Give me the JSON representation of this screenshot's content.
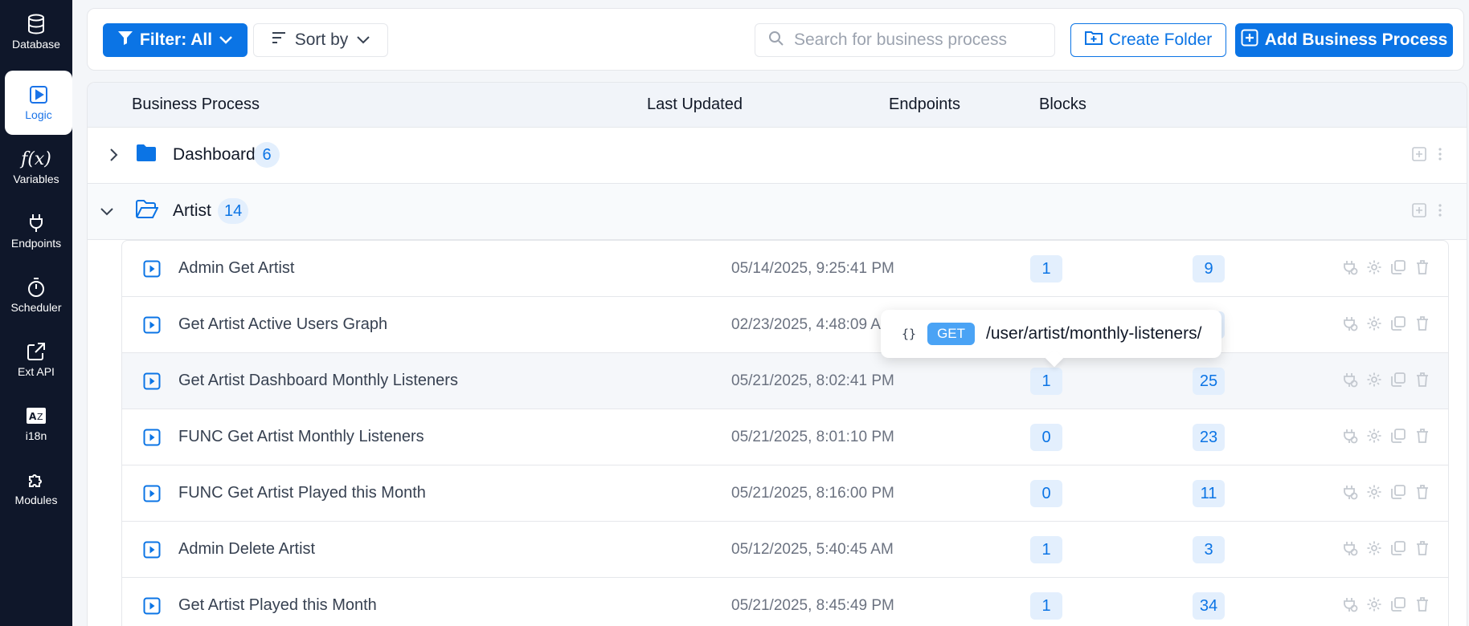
{
  "sidebar": {
    "items": [
      {
        "label": "Database",
        "icon": "database-icon"
      },
      {
        "label": "Logic",
        "icon": "play-square-icon",
        "active": true
      },
      {
        "label": "Variables",
        "icon": "function-icon"
      },
      {
        "label": "Endpoints",
        "icon": "plug-icon"
      },
      {
        "label": "Scheduler",
        "icon": "stopwatch-icon"
      },
      {
        "label": "Ext API",
        "icon": "external-link-icon"
      },
      {
        "label": "i18n",
        "icon": "translate-icon"
      },
      {
        "label": "Modules",
        "icon": "puzzle-icon"
      }
    ]
  },
  "toolbar": {
    "filter_label": "Filter: All",
    "sort_label": "Sort by",
    "search_placeholder": "Search for business process",
    "create_folder_label": "Create Folder",
    "add_process_label": "Add Business Process"
  },
  "table": {
    "headers": {
      "process": "Business Process",
      "updated": "Last Updated",
      "endpoints": "Endpoints",
      "blocks": "Blocks"
    },
    "folders": [
      {
        "name": "Dashboard",
        "count": "6",
        "expanded": false
      },
      {
        "name": "Artist",
        "count": "14",
        "expanded": true
      }
    ],
    "rows": [
      {
        "name": "Admin Get Artist",
        "updated": "05/14/2025, 9:25:41 PM",
        "endpoints": "1",
        "blocks": "9"
      },
      {
        "name": "Get Artist Active Users Graph",
        "updated": "02/23/2025, 4:48:09 AM",
        "endpoints": "",
        "blocks": ""
      },
      {
        "name": "Get Artist Dashboard Monthly Listeners",
        "updated": "05/21/2025, 8:02:41 PM",
        "endpoints": "1",
        "blocks": "25"
      },
      {
        "name": "FUNC Get Artist Monthly Listeners",
        "updated": "05/21/2025, 8:01:10 PM",
        "endpoints": "0",
        "blocks": "23"
      },
      {
        "name": "FUNC Get Artist Played this Month",
        "updated": "05/21/2025, 8:16:00 PM",
        "endpoints": "0",
        "blocks": "11"
      },
      {
        "name": "Admin Delete Artist",
        "updated": "05/12/2025, 5:40:45 AM",
        "endpoints": "1",
        "blocks": "3"
      },
      {
        "name": "Get Artist Played this Month",
        "updated": "05/21/2025, 8:45:49 PM",
        "endpoints": "1",
        "blocks": "34"
      }
    ]
  },
  "tooltip": {
    "method": "GET",
    "path": "/user/artist/monthly-listeners/"
  },
  "colors": {
    "sidebar_bg": "#0f172a",
    "accent": "#0b74e5",
    "badge_bg": "#e3effd"
  }
}
